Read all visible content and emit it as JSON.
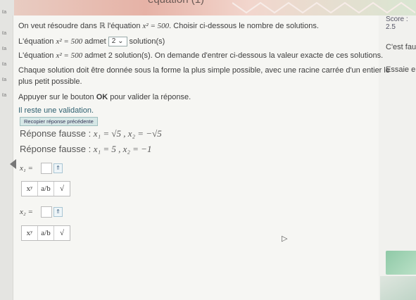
{
  "header": {
    "title": "équation (1)",
    "score": "Score : 2.5"
  },
  "question": {
    "line1_pre": "On veut résoudre dans ℝ l'équation ",
    "equation": "x² = 500",
    "line1_post": ". Choisir ci-dessous le nombre de solutions.",
    "line2_pre": "L'équation ",
    "line2_mid": " admet ",
    "select_value": "2 ⌄",
    "line2_post": " solution(s)",
    "line3_pre": "L'équation ",
    "line3_post": " admet 2 solution(s). On demande d'entrer ci-dessous la valeur exacte de ces solutions.",
    "line4": "Chaque solution doit être donnée sous la forme la plus simple possible, avec une racine carrée d'un entier le",
    "line5": "plus petit possible.",
    "line6_pre": "Appuyer sur le bouton ",
    "line6_ok": "OK",
    "line6_post": " pour valider la réponse."
  },
  "status": {
    "remaining": "Il reste une validation."
  },
  "recopier_label": "Recopier réponse précédente",
  "wrong_answers": [
    {
      "label": "Réponse fausse : ",
      "value": "x₁ = √5 , x₂ = −√5"
    },
    {
      "label": "Réponse fausse : ",
      "value": "x₁ = 5 , x₂ = −1"
    }
  ],
  "fields": [
    {
      "label": "x₁ =",
      "help": "⇑"
    },
    {
      "label": "x₂ =",
      "help": "⇑"
    }
  ],
  "keyboard": {
    "power": "xʸ",
    "fraction": "a/b",
    "sqrt": "√"
  },
  "side": {
    "feedback": "C'est fau",
    "retry": "Essaie er"
  },
  "gutter_labels": [
    "ℓa",
    "ℓa",
    "ℓa",
    "ℓa",
    "ℓa",
    "ℓa"
  ]
}
